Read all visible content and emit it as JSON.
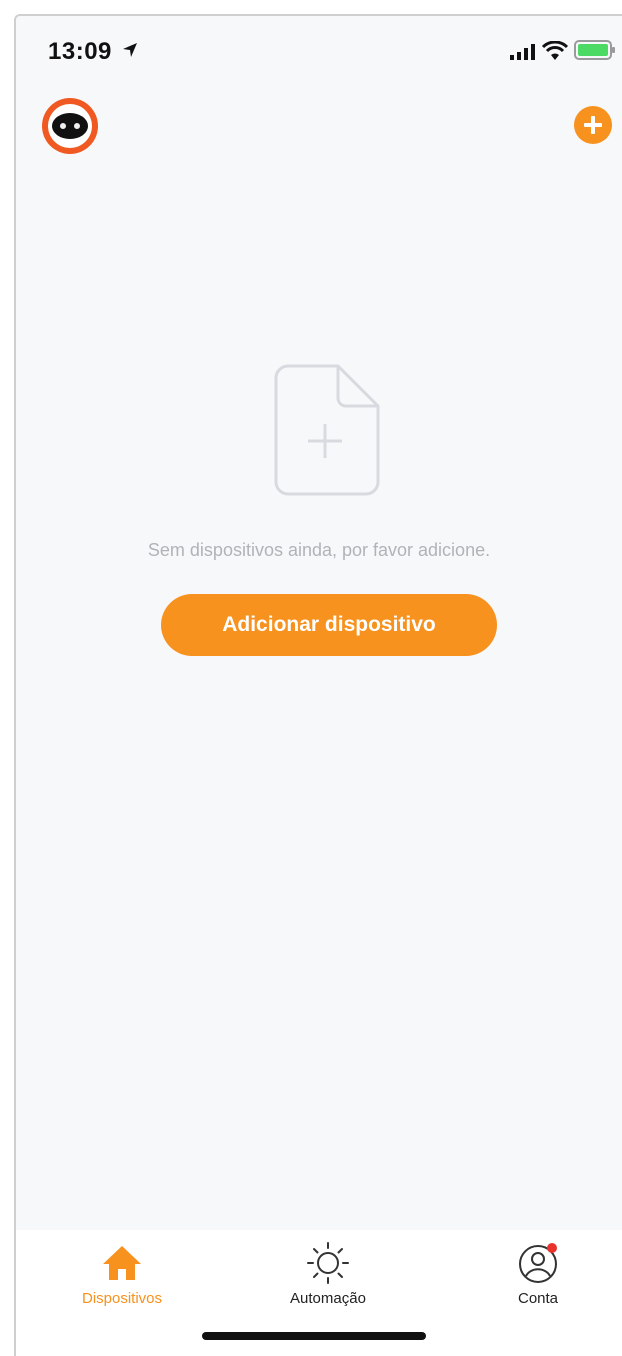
{
  "status_bar": {
    "time": "13:09",
    "icons": [
      "location-arrow-icon",
      "signal-icon",
      "wifi-icon",
      "battery-icon"
    ]
  },
  "header": {
    "avatar_icon": "robot-avatar-icon",
    "add_icon": "plus-circle-icon"
  },
  "empty_state": {
    "icon": "add-document-icon",
    "message": "Sem dispositivos ainda, por favor adicione.",
    "button_label": "Adicionar dispositivo"
  },
  "tab_bar": {
    "tabs": [
      {
        "label": "Dispositivos",
        "icon": "home-icon",
        "active": true
      },
      {
        "label": "Automação",
        "icon": "sun-icon",
        "active": false
      },
      {
        "label": "Conta",
        "icon": "user-icon",
        "active": false,
        "badge": true
      }
    ]
  },
  "colors": {
    "accent": "#f7921e",
    "avatar_ring": "#f05a22",
    "background": "#f7f8f9",
    "muted_text": "#b0b3b8",
    "badge": "#e8322b"
  }
}
